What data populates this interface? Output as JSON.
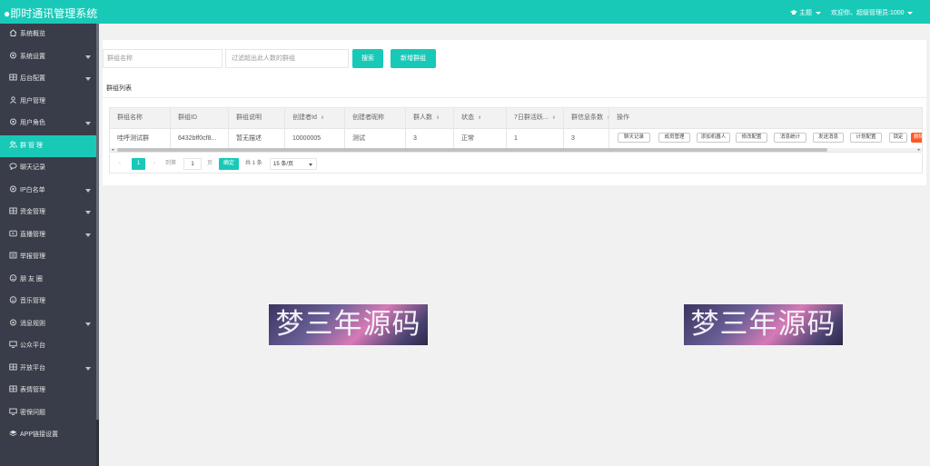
{
  "header": {
    "title": "●即时通讯管理系统",
    "theme_label": "主题",
    "welcome_text": "欢迎你、超级管理员:1000"
  },
  "sidebar": {
    "items": [
      {
        "label": "系统概览",
        "icon": "home-icon",
        "has_children": false,
        "active": false
      },
      {
        "label": "系统设置",
        "icon": "gear-icon",
        "has_children": true,
        "active": false
      },
      {
        "label": "后台配置",
        "icon": "grid-icon",
        "has_children": true,
        "active": false
      },
      {
        "label": "用户管理",
        "icon": "user-icon",
        "has_children": false,
        "active": false
      },
      {
        "label": "用户角色",
        "icon": "gear-icon",
        "has_children": true,
        "active": false
      },
      {
        "label": "群 管 理",
        "icon": "group-icon",
        "has_children": false,
        "active": true
      },
      {
        "label": "聊天记录",
        "icon": "chat-icon",
        "has_children": false,
        "active": false
      },
      {
        "label": "IP白名单",
        "icon": "gear-icon",
        "has_children": true,
        "active": false
      },
      {
        "label": "资金管理",
        "icon": "grid-icon",
        "has_children": true,
        "active": false
      },
      {
        "label": "直播管理",
        "icon": "video-icon",
        "has_children": true,
        "active": false
      },
      {
        "label": "举报管理",
        "icon": "report-icon",
        "has_children": false,
        "active": false
      },
      {
        "label": "朋 友 圈",
        "icon": "smile-icon",
        "has_children": false,
        "active": false
      },
      {
        "label": "音乐管理",
        "icon": "smile-icon",
        "has_children": false,
        "active": false
      },
      {
        "label": "消息规则",
        "icon": "gear-icon",
        "has_children": true,
        "active": false
      },
      {
        "label": "公众平台",
        "icon": "monitor-icon",
        "has_children": false,
        "active": false
      },
      {
        "label": "开放平台",
        "icon": "grid-icon",
        "has_children": true,
        "active": false
      },
      {
        "label": "表情管理",
        "icon": "grid-icon",
        "has_children": false,
        "active": false
      },
      {
        "label": "密保问题",
        "icon": "monitor-icon",
        "has_children": false,
        "active": false
      },
      {
        "label": "APP链接设置",
        "icon": "layers-icon",
        "has_children": false,
        "active": false
      }
    ]
  },
  "search": {
    "group_name_placeholder": "群组名称",
    "min_members_placeholder": "过滤超出此人数的群组",
    "search_button": "搜索",
    "add_button": "新增群组"
  },
  "list": {
    "title": "群组列表",
    "columns": [
      "群组名称",
      "群组ID",
      "群组说明",
      "创建者Id",
      "创建者昵称",
      "群人数",
      "状态",
      "7日群活跃...",
      "群信息条数",
      "操作"
    ],
    "sortable": [
      false,
      false,
      false,
      true,
      false,
      true,
      true,
      true,
      true,
      false
    ],
    "rows": [
      {
        "cells": [
          "哇呼测试群",
          "6432bff0cf8...",
          "暂无描述",
          "10000005",
          "测试",
          "3",
          "正常",
          "1",
          "3"
        ],
        "actions": [
          "聊天记录",
          "成员管理",
          "添加机器人",
          "修改配置",
          "消息统计",
          "发送消息",
          "计划配置",
          "锁定",
          "删除"
        ]
      }
    ]
  },
  "pagination": {
    "prev": "‹",
    "current_page": "1",
    "next": "›",
    "goto_label": "到第",
    "page_input": "1",
    "page_suffix": "页",
    "confirm_button": "确定",
    "total_text": "共 1 条",
    "page_size": "15 条/页"
  },
  "watermarks": [
    "梦三年源码",
    "梦三年源码"
  ],
  "colors": {
    "accent": "#19c9b8",
    "sidebar_bg": "#393d49",
    "danger": "#ff5722"
  }
}
